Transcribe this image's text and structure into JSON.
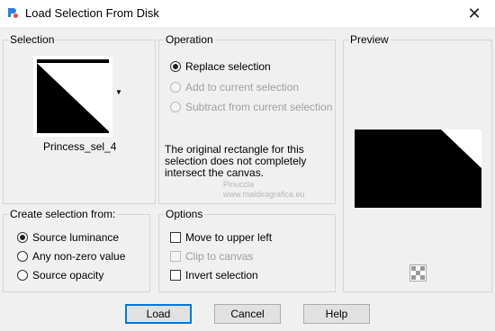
{
  "window": {
    "title": "Load Selection From Disk"
  },
  "selection": {
    "group_label": "Selection",
    "file_name": "Princess_sel_4"
  },
  "operation": {
    "group_label": "Operation",
    "options": [
      {
        "label": "Replace selection",
        "checked": true,
        "enabled": true
      },
      {
        "label": "Add to current selection",
        "checked": false,
        "enabled": false
      },
      {
        "label": "Subtract from current selection",
        "checked": false,
        "enabled": false
      }
    ],
    "warning": "The original rectangle for this selection does not completely intersect the canvas."
  },
  "preview": {
    "group_label": "Preview"
  },
  "create_from": {
    "group_label": "Create selection from:",
    "options": [
      {
        "label": "Source luminance",
        "checked": true
      },
      {
        "label": "Any non-zero value",
        "checked": false
      },
      {
        "label": "Source opacity",
        "checked": false
      }
    ]
  },
  "options": {
    "group_label": "Options",
    "items": [
      {
        "label": "Move to upper left",
        "checked": false,
        "enabled": true
      },
      {
        "label": "Clip to canvas",
        "checked": false,
        "enabled": false
      },
      {
        "label": "Invert selection",
        "checked": false,
        "enabled": true
      }
    ]
  },
  "watermark": {
    "line1": "Pinuccia",
    "line2": "www.maldiragrafica.eu"
  },
  "buttons": {
    "load": "Load",
    "cancel": "Cancel",
    "help": "Help"
  },
  "icons": {
    "app": "paint-shop-pro-icon",
    "close": "close-icon",
    "dropdown": "chevron-down-icon",
    "zoom": "checker-zoom-icon"
  }
}
